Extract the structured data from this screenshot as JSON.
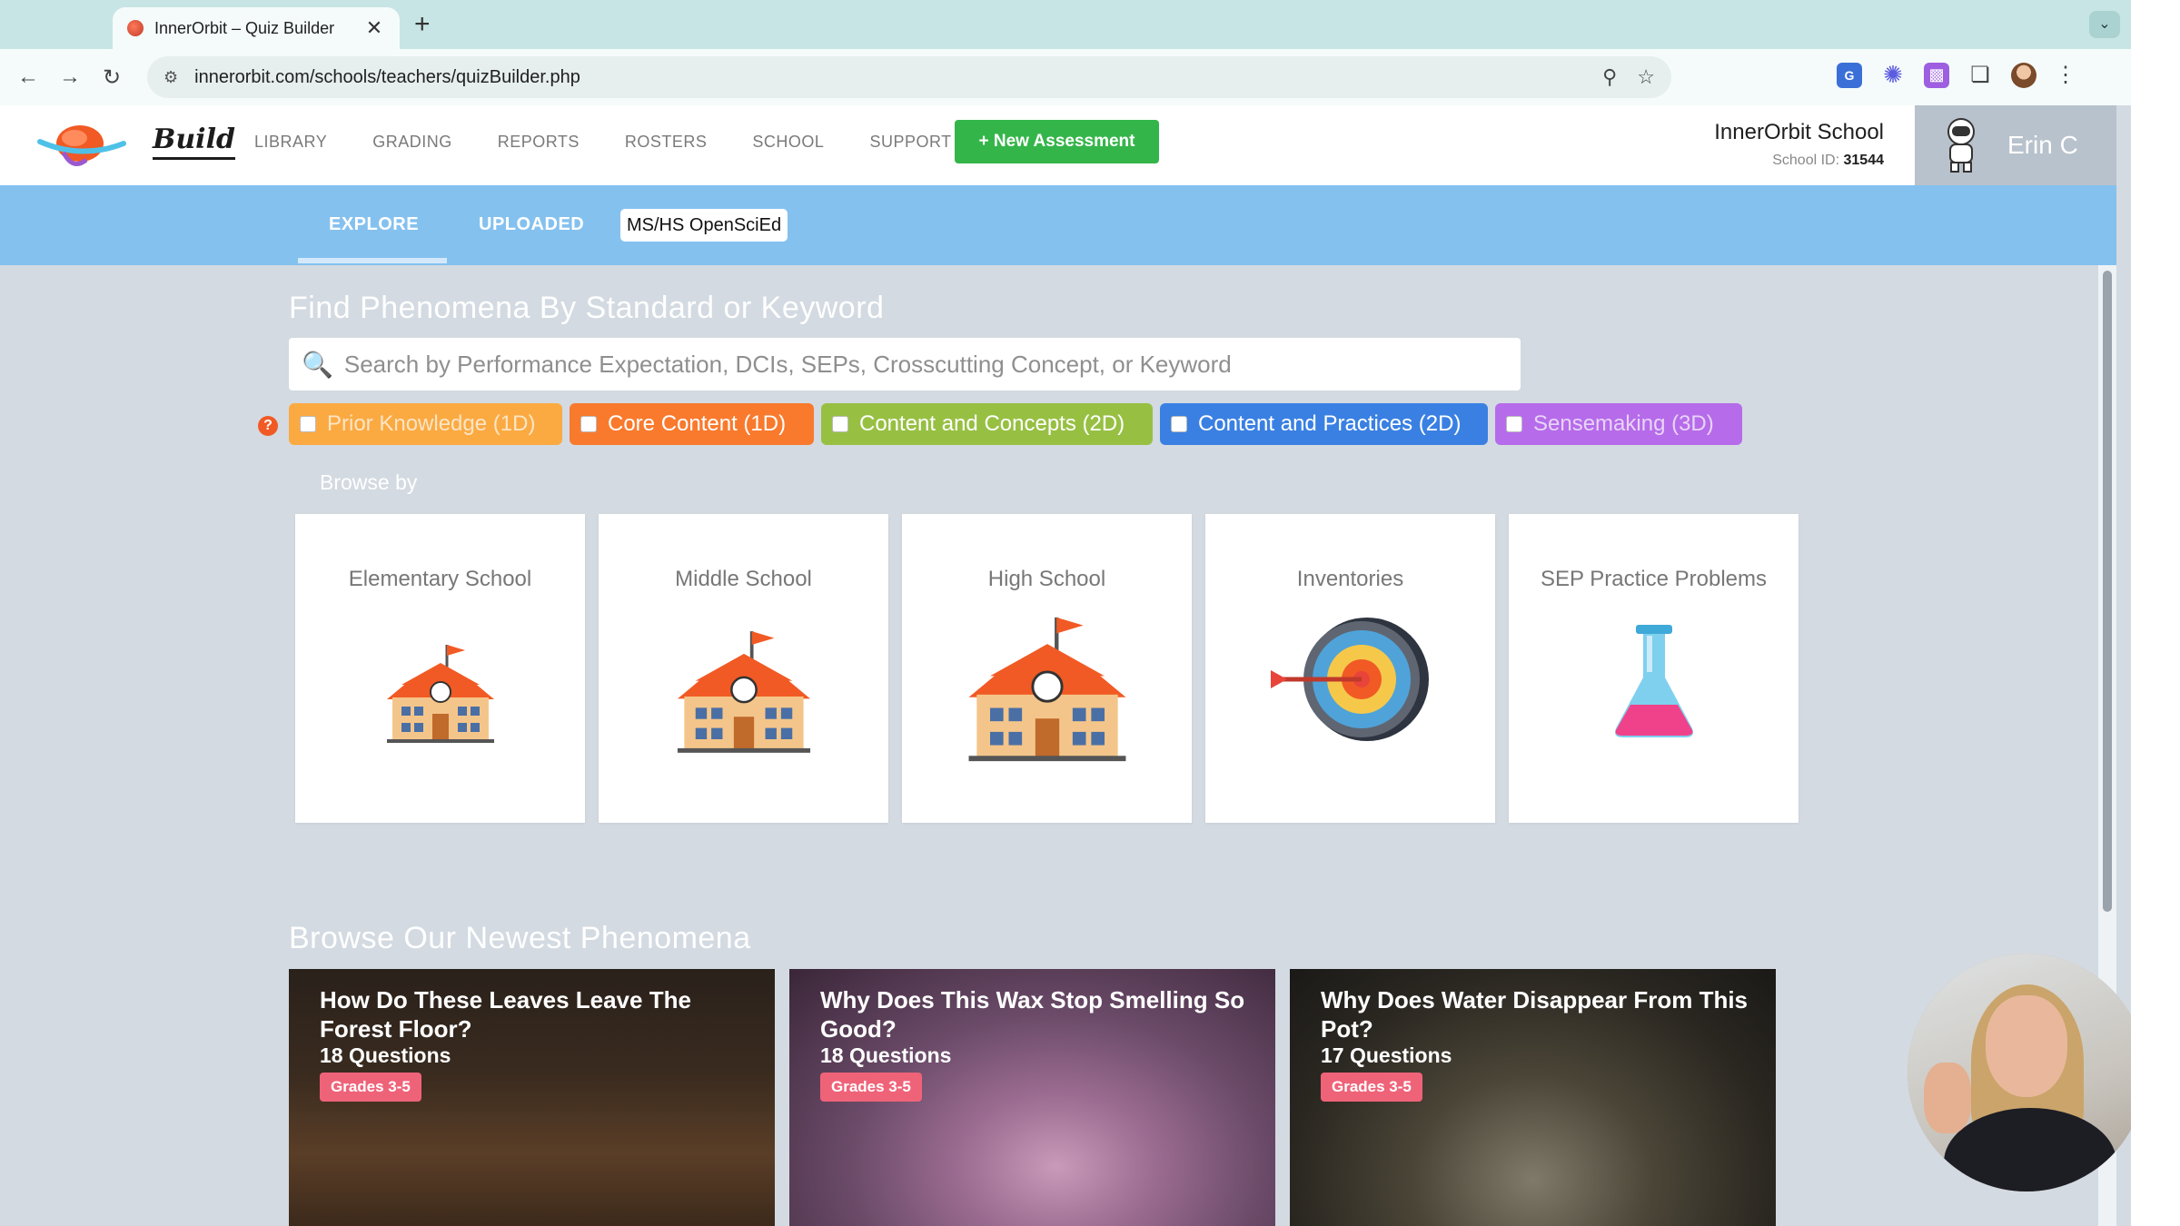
{
  "browser": {
    "tab_title": "InnerOrbit – Quiz Builder",
    "tab_close": "✕",
    "new_tab": "+",
    "url": "innerorbit.com/schools/teachers/quizBuilder.php"
  },
  "header": {
    "brand": "Build",
    "nav": [
      "LIBRARY",
      "GRADING",
      "REPORTS",
      "ROSTERS",
      "SCHOOL",
      "SUPPORT"
    ],
    "new_assessment": "+ New Assessment",
    "school_name": "InnerOrbit School",
    "school_id_label": "School ID:",
    "school_id": "31544",
    "user_name": "Erin C"
  },
  "subtabs": {
    "explore": "EXPLORE",
    "uploaded": "UPLOADED",
    "openscied": "MS/HS OpenSciEd"
  },
  "search": {
    "title": "Find Phenomena By Standard or Keyword",
    "placeholder": "Search by Performance Expectation, DCIs, SEPs, Crosscutting Concept, or Keyword",
    "help": "?"
  },
  "filters": [
    {
      "label": "Prior Knowledge (1D)",
      "color": "#fbaa42"
    },
    {
      "label": "Core Content (1D)",
      "color": "#f97a2d"
    },
    {
      "label": "Content and Concepts (2D)",
      "color": "#97c043"
    },
    {
      "label": "Content and Practices (2D)",
      "color": "#3a80e3"
    },
    {
      "label": "Sensemaking (3D)",
      "color": "#b66bea"
    }
  ],
  "browse": {
    "label": "Browse by",
    "cards": [
      {
        "title": "Elementary School",
        "icon": "school-building-icon"
      },
      {
        "title": "Middle School",
        "icon": "school-building-icon"
      },
      {
        "title": "High School",
        "icon": "school-building-icon"
      },
      {
        "title": "Inventories",
        "icon": "target-icon"
      },
      {
        "title": "SEP Practice Problems",
        "icon": "flask-icon"
      }
    ]
  },
  "newest": {
    "title": "Browse Our Newest Phenomena",
    "items": [
      {
        "title": "How Do These Leaves Leave The Forest Floor?",
        "questions": "18 Questions",
        "grade": "Grades 3-5"
      },
      {
        "title": "Why Does This Wax Stop Smelling So Good?",
        "questions": "18 Questions",
        "grade": "Grades 3-5"
      },
      {
        "title": "Why Does Water Disappear From This Pot?",
        "questions": "17 Questions",
        "grade": "Grades 3-5"
      }
    ]
  },
  "colors": {
    "accent_green": "#34b54a",
    "subtab_blue": "#84c1ef",
    "grade_badge": "#ef6379"
  }
}
